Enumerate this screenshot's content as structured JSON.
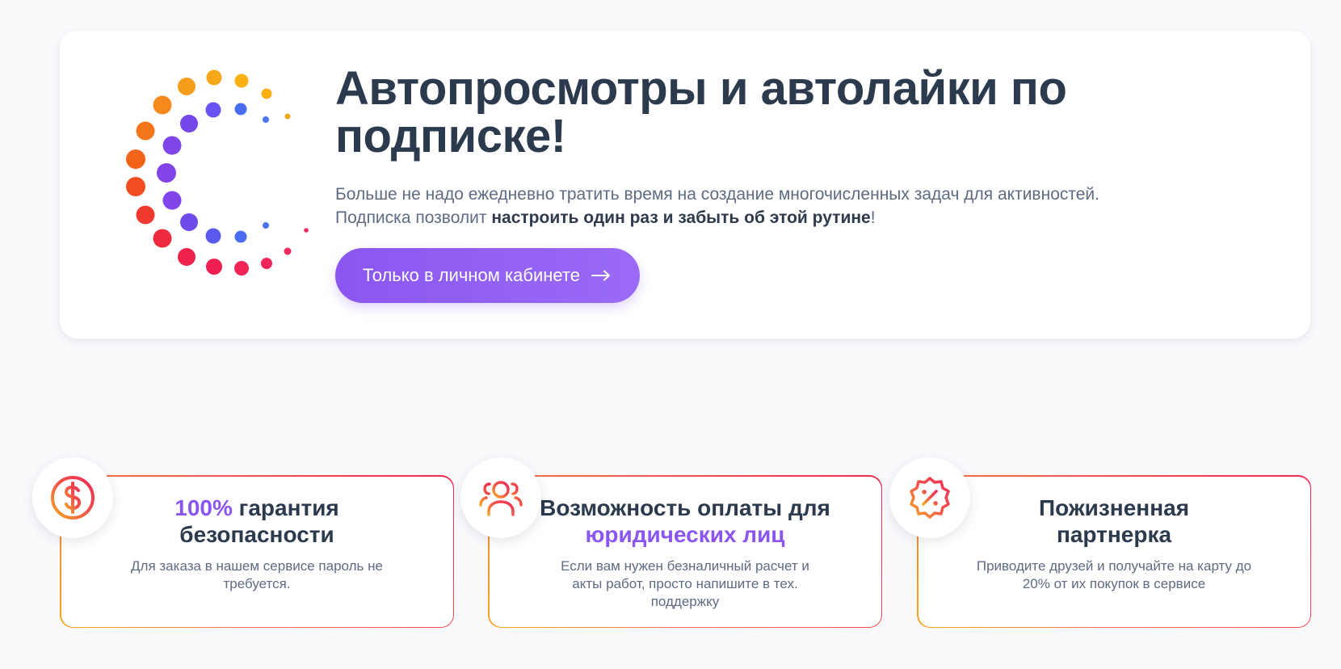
{
  "hero": {
    "title_line1": "Автопросмотры и автолайки по",
    "title_line2": "подписке!",
    "desc_line1": "Больше не надо ежедневно тратить время на создание многочисленных задач для активностей.",
    "desc_line2_pre": "Подписка позволит ",
    "desc_line2_bold": "настроить один раз и забыть об этой рутине",
    "desc_line2_post": "!",
    "cta_label": "Только в личном кабинете",
    "cta_icon": "arrow-right-icon",
    "logo_icon": "dotted-spiral-logo"
  },
  "features": [
    {
      "icon": "dollar-coin-icon",
      "title_accent": "100%",
      "title_rest": " гарантия безопасности",
      "desc": "Для заказа в нашем сервисе пароль не требуется."
    },
    {
      "icon": "users-icon",
      "title_pre": "Возможность оплаты для ",
      "title_accent": "юридических лиц",
      "desc": "Если вам нужен безналичный расчет и акты работ, просто напишите в тех. поддержку"
    },
    {
      "icon": "discount-badge-icon",
      "title": "Пожизненная партнерка",
      "desc": "Приводите друзей и получайте на карту до 20% от их покупок в сервисе"
    }
  ],
  "colors": {
    "accent_purple": "#8b56f0",
    "title_dark": "#2c3a4d",
    "text_gray": "#5e6b83",
    "gradient_orange": "#f5a623",
    "gradient_red": "#ee2a55",
    "blue_dot": "#4a6cf0"
  }
}
